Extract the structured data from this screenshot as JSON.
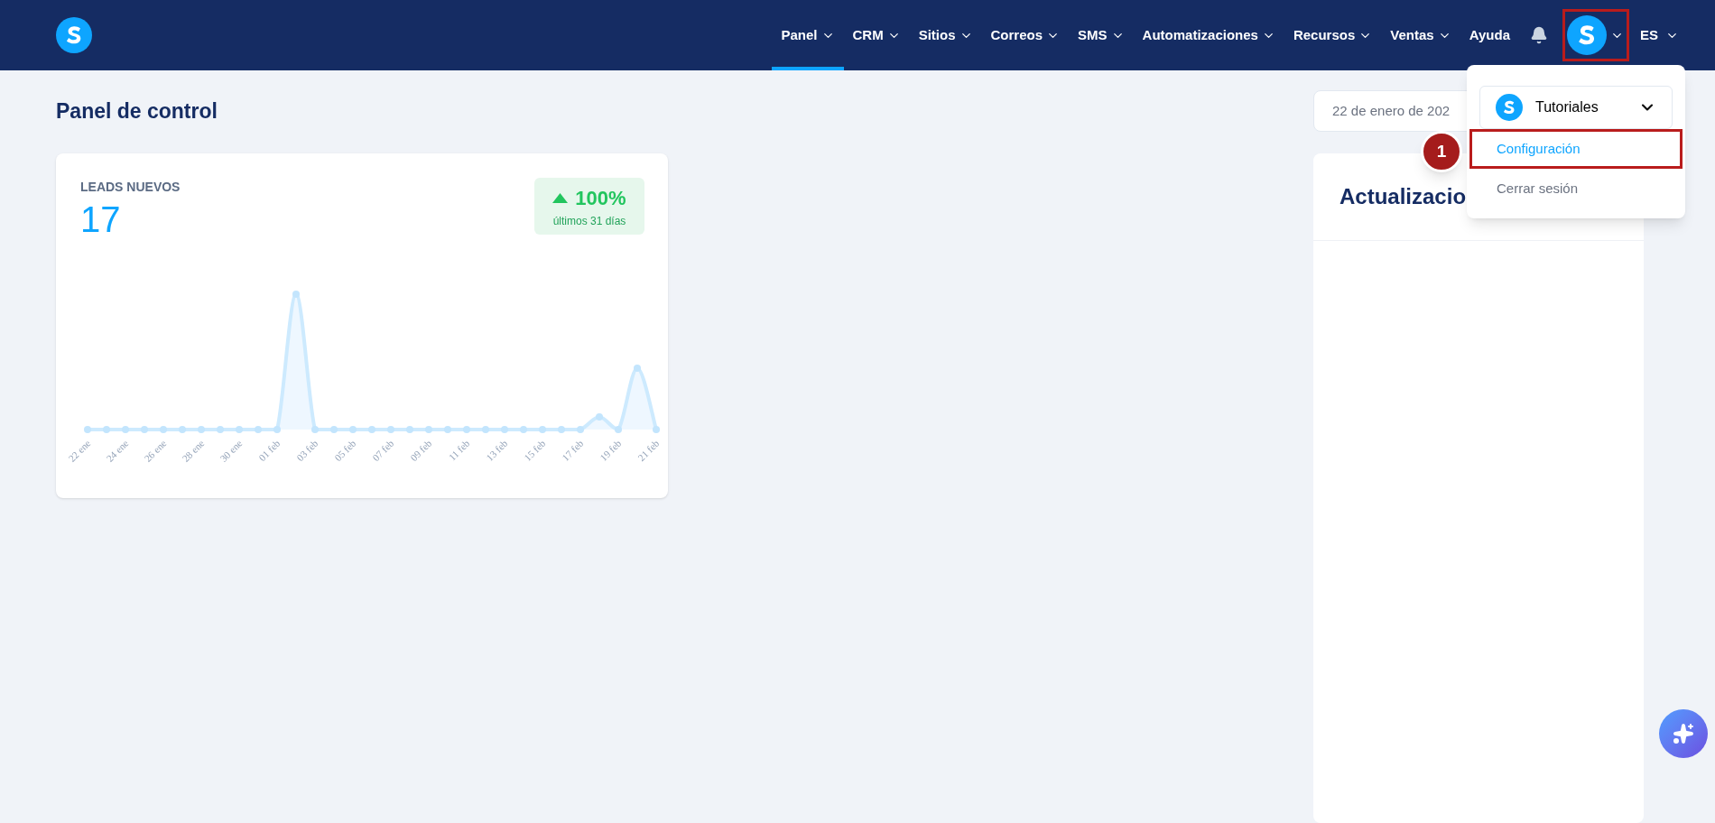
{
  "nav": {
    "items": [
      {
        "label": "Panel",
        "selected": true,
        "has_menu": true
      },
      {
        "label": "CRM",
        "selected": false,
        "has_menu": true
      },
      {
        "label": "Sitios",
        "selected": false,
        "has_menu": true
      },
      {
        "label": "Correos",
        "selected": false,
        "has_menu": true
      },
      {
        "label": "SMS",
        "selected": false,
        "has_menu": true
      },
      {
        "label": "Automatizaciones",
        "selected": false,
        "has_menu": true
      },
      {
        "label": "Recursos",
        "selected": false,
        "has_menu": true
      },
      {
        "label": "Ventas",
        "selected": false,
        "has_menu": true
      },
      {
        "label": "Ayuda",
        "selected": false,
        "has_menu": false
      }
    ],
    "language": "ES"
  },
  "page": {
    "title": "Panel de control",
    "date_range": "22 de enero de 202"
  },
  "leads_card": {
    "title": "LEADS NUEVOS",
    "value": "17",
    "change": "100%",
    "period": "últimos 31 días",
    "x_labels": [
      "22 ene",
      "24 ene",
      "26 ene",
      "28 ene",
      "30 ene",
      "01 feb",
      "03 feb",
      "05 feb",
      "07 feb",
      "09 feb",
      "11 feb",
      "13 feb",
      "15 feb",
      "17 feb",
      "19 feb",
      "21 feb"
    ]
  },
  "updates_card": {
    "title": "Actualizacio"
  },
  "account_menu": {
    "account": "Tutoriales",
    "items": [
      {
        "label": "Configuración",
        "selected": true
      },
      {
        "label": "Cerrar sesión",
        "selected": false
      }
    ]
  },
  "callout": {
    "number": "1"
  }
}
